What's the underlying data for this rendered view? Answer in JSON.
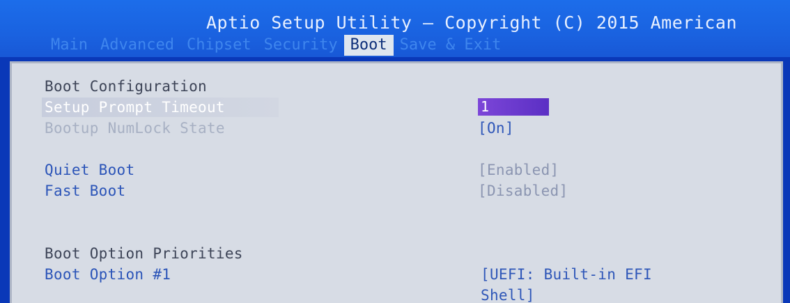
{
  "header": {
    "title": "Aptio Setup Utility – Copyright (C) 2015 American"
  },
  "tabs": [
    {
      "label": "Main"
    },
    {
      "label": "Advanced"
    },
    {
      "label": "Chipset"
    },
    {
      "label": "Security"
    },
    {
      "label": "Boot"
    },
    {
      "label": "Save & Exit"
    }
  ],
  "active_tab": "Boot",
  "content": {
    "section1": "Boot Configuration",
    "setup_prompt_timeout": {
      "label": "Setup Prompt Timeout",
      "value": "1"
    },
    "bootup_numlock": {
      "label": "Bootup NumLock State",
      "value": "[On]"
    },
    "quiet_boot": {
      "label": "Quiet Boot",
      "value": "[Enabled]"
    },
    "fast_boot": {
      "label": "Fast Boot",
      "value": "[Disabled]"
    },
    "section2": "Boot Option Priorities",
    "boot_option_1": {
      "label": "Boot Option #1",
      "value_line1": "[UEFI: Built-in EFI",
      "value_line2": "Shell]"
    }
  },
  "colors": {
    "header_bg": "#1a62e0",
    "panel_bg": "#d7dce5",
    "highlight": "#7c46d8",
    "active_tab_bg": "#dfe6ef"
  }
}
